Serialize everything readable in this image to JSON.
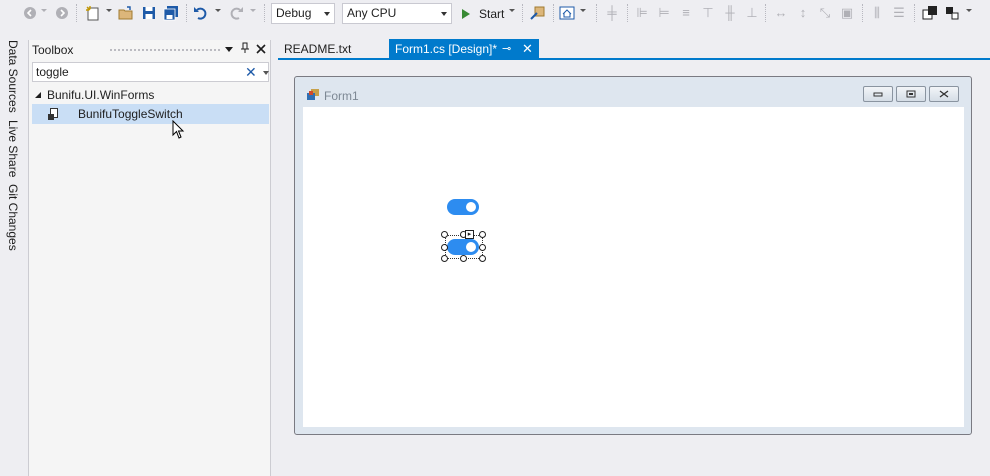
{
  "toolbar": {
    "configuration": "Debug",
    "platform": "Any CPU",
    "start_label": "Start",
    "icons": [
      "back-icon",
      "forward-icon",
      "new-item-icon",
      "open-file-icon",
      "save-icon",
      "save-all-icon",
      "undo-icon",
      "redo-icon",
      "attach-icon",
      "home-icon",
      "layout-icons"
    ]
  },
  "side_tabs": [
    "Data Sources",
    "Live Share",
    "Git Changes"
  ],
  "toolbox": {
    "title": "Toolbox",
    "search_value": "toggle",
    "group": "Bunifu.UI.WinForms",
    "item": "BunifuToggleSwitch"
  },
  "documents": {
    "tabs": [
      {
        "label": "README.txt",
        "active": false
      },
      {
        "label": "Form1.cs [Design]*",
        "active": true
      }
    ]
  },
  "form": {
    "title": "Form1",
    "toggles": [
      {
        "state": "on",
        "selected": false
      },
      {
        "state": "on",
        "selected": true
      }
    ]
  },
  "colors": {
    "accent": "#007acc",
    "toggle_on": "#2d8cf0",
    "selection": "#c9def5"
  }
}
